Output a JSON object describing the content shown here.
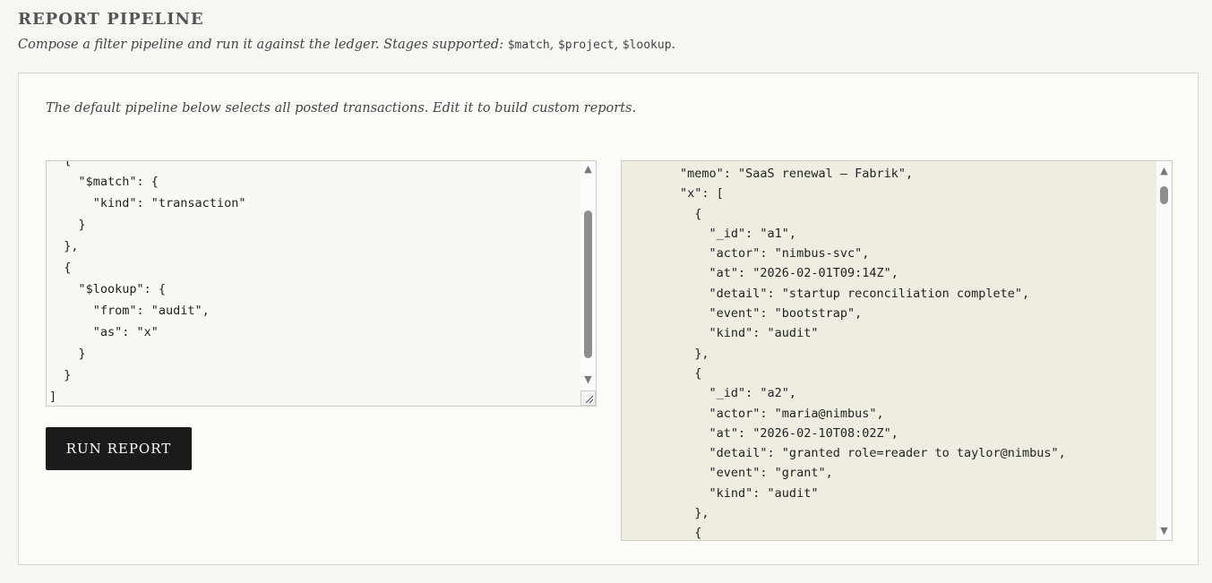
{
  "header": {
    "title": "REPORT PIPELINE",
    "subtitle_prefix": "Compose a filter pipeline and run it against the ledger. Stages supported: ",
    "stage_match": "$match",
    "stage_project": "$project",
    "stage_lookup": "$lookup",
    "sep1": ", ",
    "sep2": ", ",
    "subtitle_suffix": "."
  },
  "panel": {
    "description": "The default pipeline below selects all posted transactions. Edit it to build custom reports."
  },
  "editor": {
    "value": "  {\n    \"$match\": {\n      \"kind\": \"transaction\"\n    }\n  },\n  {\n    \"$lookup\": {\n      \"from\": \"audit\",\n      \"as\": \"x\"\n    }\n  }\n]"
  },
  "actions": {
    "run_label": "RUN REPORT"
  },
  "output": {
    "value": "        \"memo\": \"SaaS renewal — Fabrik\",\n        \"x\": [\n          {\n            \"_id\": \"a1\",\n            \"actor\": \"nimbus-svc\",\n            \"at\": \"2026-02-01T09:14Z\",\n            \"detail\": \"startup reconciliation complete\",\n            \"event\": \"bootstrap\",\n            \"kind\": \"audit\"\n          },\n          {\n            \"_id\": \"a2\",\n            \"actor\": \"maria@nimbus\",\n            \"at\": \"2026-02-10T08:02Z\",\n            \"detail\": \"granted role=reader to taylor@nimbus\",\n            \"event\": \"grant\",\n            \"kind\": \"audit\"\n          },\n          {"
  },
  "icons": {
    "scroll_up": "scroll-up-arrow-icon",
    "scroll_down": "scroll-down-arrow-icon",
    "resize": "resize-grip-icon"
  },
  "colors": {
    "button_bg": "#1c1b1a",
    "editor_bg": "#faf8f2",
    "output_bg": "#efede2",
    "page_bg": "#f7f6f2"
  }
}
